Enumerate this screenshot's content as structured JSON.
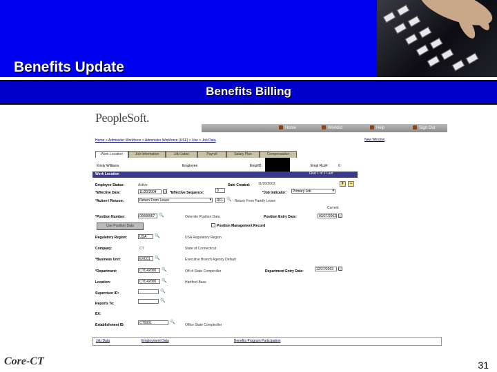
{
  "slide": {
    "title": "Benefits Update",
    "subtitle": "Benefits Billing",
    "page_number": "31",
    "logo_text": "Core-CT"
  },
  "colors": {
    "header_blue": "#0000f0",
    "bar_blue": "#0000cc",
    "tab_tan": "#c8c1a6"
  },
  "app": {
    "logo": "PeopleSoft.",
    "nav": [
      {
        "label": "Home",
        "icon": "home-icon"
      },
      {
        "label": "Worklist",
        "icon": "worklist-icon"
      },
      {
        "label": "Help",
        "icon": "help-icon"
      },
      {
        "label": "Sign Out",
        "icon": "signout-icon"
      }
    ],
    "breadcrumb": "Home > Administer Workforce > Administer Workforce (USF) > Use > Job Data",
    "new_window": "New Window",
    "tabs": [
      "Work Location",
      "Job Information",
      "Job Labor",
      "Payroll",
      "Salary Plan",
      "Compensation"
    ],
    "header": {
      "name_label": "Kristy Williams",
      "employee_label": "Employee",
      "empl_id_label": "EmplID:",
      "empl_rcd_label": "Empl Rcd#:",
      "empl_rcd_value": "0"
    },
    "work_location": {
      "bar_label": "Work Location",
      "pager": "First  1 of 1  Last",
      "employee_status_label": "Employee Status:",
      "employee_status_value": "Active",
      "date_created_label": "Date Created:",
      "date_created_value": "11/20/2003",
      "effective_date_label": "*Effective Date:",
      "effective_date_value": "11/20/2004",
      "effective_seq_label": "*Effective Sequence:",
      "effective_seq_value": "0",
      "job_indicator_label": "*Job Indicator:",
      "job_indicator_value": "Primary Job",
      "action_reason_label": "*Action / Reason:",
      "action_value": "Return From Leave",
      "reason_value": "RFL",
      "reason_desc": "Return From Family Leave",
      "current_label": "Current",
      "position_number_label": "*Position Number:",
      "position_number_value": "00000067",
      "override_label": "Override Position Data",
      "position_entry_label": "Position Entry Date:",
      "position_entry_value": "03/27/2002",
      "position_mgmt_label": "Position Management Record",
      "use_position_button": "Use Position Data",
      "reg_region_label": "Regulatory Region:",
      "reg_region_value": "USA",
      "reg_region_desc": "USA Regulatory Region",
      "company_label": "Company:",
      "company_value": "CT",
      "company_desc": "State of Connecticut",
      "business_unit_label": "*Business Unit:",
      "business_unit_value": "EXC01",
      "business_unit_desc": "Executive Branch Agency Default",
      "department_label": "*Department:",
      "department_value": "CTC42000",
      "department_desc": "Off of State Comptroller",
      "dept_entry_label": "Department Entry Date:",
      "dept_entry_value": "12/27/2003",
      "location_label": "Location:",
      "location_value": "CTC42000",
      "location_desc": "Hartford Base",
      "supervisor_label": "Supervisor ID:",
      "reports_to_label": "Reports To:",
      "ex_label": "EX:",
      "establishment_label": "Establishment ID:",
      "establishment_value": "CT0001",
      "establishment_desc": "Office State Comptroller"
    },
    "bottom_links": [
      "Job Data",
      "Employment Data",
      "Benefits Program Participation"
    ]
  }
}
